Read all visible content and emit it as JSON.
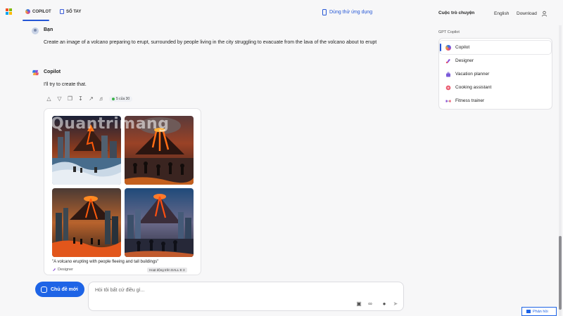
{
  "header": {
    "tabs": [
      {
        "label": "COPILOT",
        "active": true
      },
      {
        "label": "SỔ TAY",
        "active": false
      }
    ],
    "try_app": "Dùng thử ứng dụng",
    "conversations": "Cuộc trò chuyện",
    "language": "English",
    "download": "Download"
  },
  "chat": {
    "user_name": "Bạn",
    "user_message": "Create an image of a volcano preparing to erupt, surrounded by people living in the city struggling to evacuate from the lava of the volcano about to erupt",
    "copilot_name": "Copilot",
    "copilot_message": "I'll try to create that.",
    "counter": "5 của 30",
    "image_caption": "\"A volcano erupting with people fleeing and tall buildings\"",
    "image_source": "Designer",
    "image_engine": "Hoạt động trên DALL·E 3",
    "watermark": "Quantrimang"
  },
  "sidebar": {
    "gpt_label": "GPT Copilot",
    "items": [
      {
        "label": "Copilot",
        "icon": "copilot-icon",
        "active": true
      },
      {
        "label": "Designer",
        "icon": "designer-icon",
        "active": false
      },
      {
        "label": "Vacation planner",
        "icon": "suitcase-icon",
        "active": false
      },
      {
        "label": "Cooking assistant",
        "icon": "cooking-icon",
        "active": false
      },
      {
        "label": "Fitness trainer",
        "icon": "dumbbell-icon",
        "active": false
      }
    ]
  },
  "composer": {
    "new_topic": "Chủ đề mới",
    "placeholder": "Hỏi tôi bất cứ điều gì..."
  },
  "feedback": "Phản hồi",
  "colors": {
    "accent": "#1e64e6",
    "background": "#f7f7f8"
  }
}
